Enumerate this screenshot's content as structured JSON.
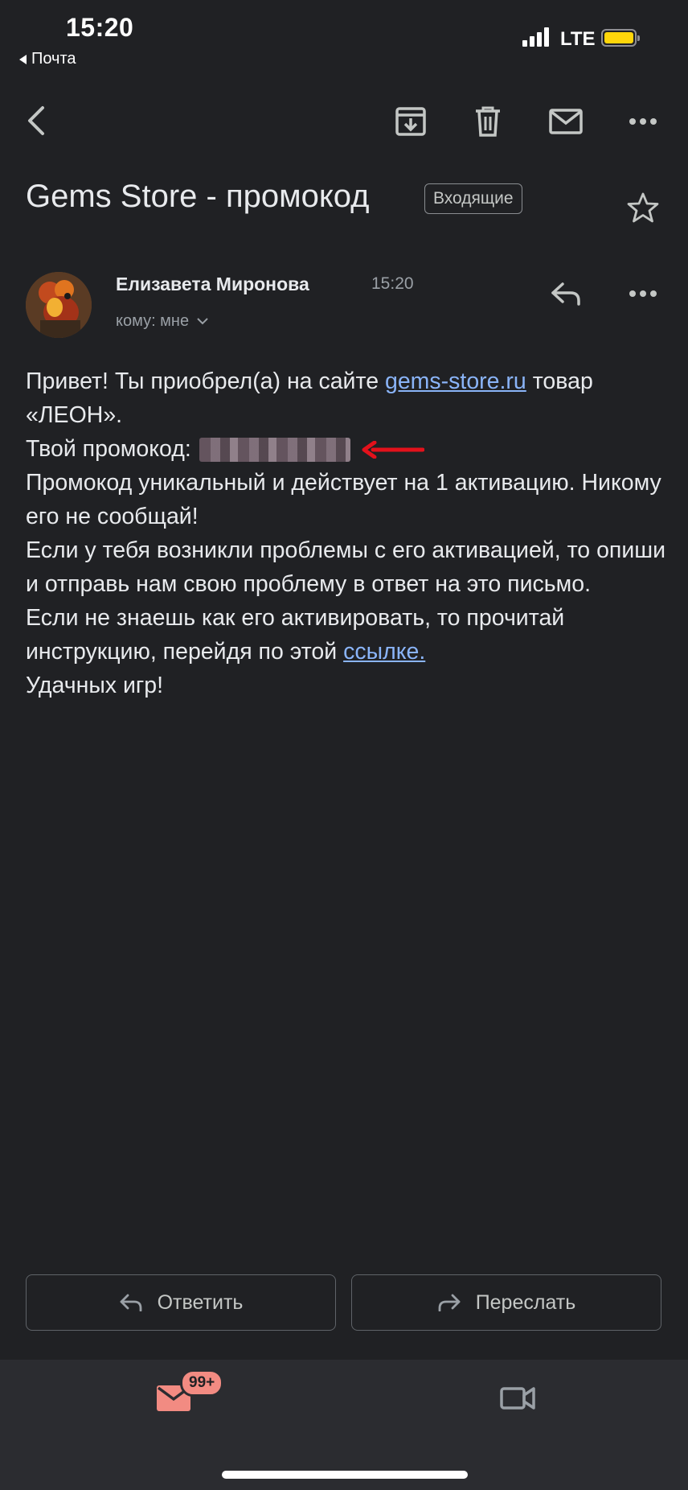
{
  "status_bar": {
    "time": "15:20",
    "back_app": "Почта",
    "network": "LTE"
  },
  "toolbar": {
    "icons": [
      "back-icon",
      "archive-icon",
      "trash-icon",
      "mail-icon",
      "more-icon"
    ]
  },
  "email": {
    "subject": "Gems Store - промокод",
    "label": "Входящие",
    "sender": "Елизавета Миронова",
    "time": "15:20",
    "recipient": "кому: мне",
    "body": {
      "line1_prefix": "Привет! Ты приобрел(а) на сайте ",
      "site_link": "gems-store.ru",
      "line1_suffix": " товар «ЛЕОН».",
      "promo_label": "Твой промокод:",
      "p3": "Промокод уникальный и действует на 1 активацию. Никому его не сообщай!",
      "p4": "Если у тебя возникли проблемы с его активацией, то опиши и отправь нам свою проблему в ответ на это письмо.",
      "p5_prefix": "Если не знаешь как его активировать, то прочитай инструкцию, перейдя по этой ",
      "link_text": "ссылке.",
      "p6": "Удачных игр!"
    }
  },
  "actions": {
    "reply": "Ответить",
    "forward": "Переслать"
  },
  "bottom_nav": {
    "mail_badge": "99+",
    "accent": "#f28b82"
  },
  "colors": {
    "background": "#202124",
    "link": "#8ab4f8",
    "arrow": "#e3111b"
  }
}
